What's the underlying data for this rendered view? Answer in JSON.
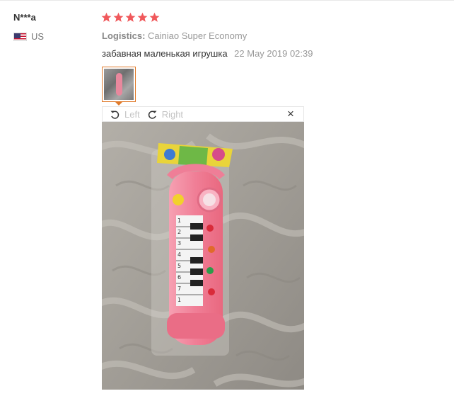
{
  "review": {
    "user_name": "N***a",
    "country_code": "US",
    "rating": 5,
    "logistics_label": "Logistics:",
    "logistics_value": "Cainiao Super Economy",
    "text": "забавная маленькая игрушка",
    "date": "22 May 2019 02:39"
  },
  "viewer": {
    "rotate_left_label": "Left",
    "rotate_right_label": "Right",
    "close_label": "×"
  },
  "colors": {
    "star": "#f0585b",
    "thumb_border": "#e07a2a",
    "toy_pink": "#f07e96"
  },
  "icons": {
    "rotate_left": "rotate-ccw-icon",
    "rotate_right": "rotate-cw-icon",
    "close": "close-icon",
    "flag": "us-flag-icon"
  },
  "photo": {
    "keys_numbers": [
      "1",
      "2",
      "3",
      "4",
      "5",
      "6",
      "7",
      "1"
    ]
  }
}
